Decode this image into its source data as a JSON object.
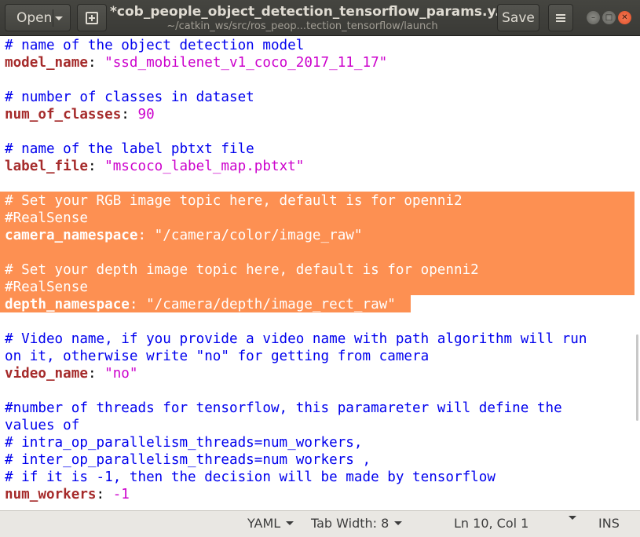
{
  "header": {
    "open_label": "Open",
    "save_label": "Save",
    "title": "*cob_people_object_detection_tensorflow_params.y...",
    "subtitle": "~/catkin_ws/src/ros_peop...tection_tensorflow/launch"
  },
  "lines": {
    "l1": "# name of the object detection model",
    "l2_key": "model_name",
    "l2_sep": ": ",
    "l2_val": "\"ssd_mobilenet_v1_coco_2017_11_17\"",
    "l4": "# number of classes in dataset",
    "l5_key": "num_of_classes",
    "l5_sep": ": ",
    "l5_val": "90",
    "l7": "# name of the label pbtxt file",
    "l8_key": "label_file",
    "l8_sep": ": ",
    "l8_val": "\"mscoco_label_map.pbtxt\"",
    "l10": "# Set your RGB image topic here, default is for openni2",
    "l11": "#RealSense",
    "l12_key": "camera_namespace",
    "l12_sep": ": ",
    "l12_val": "\"/camera/color/image_raw\"",
    "l14": "# Set your depth image topic here, default is for openni2",
    "l15": "#RealSense",
    "l16_key": "depth_namespace",
    "l16_sep": ": ",
    "l16_val": "\"/camera/depth/image_rect_raw\"",
    "l18": "# Video name, if you provide a video name with path algorithm will run",
    "l19": "on it, otherwise write \"no\" for getting from camera",
    "l20_key": "video_name",
    "l20_sep": ": ",
    "l20_val": "\"no\"",
    "l22": "#number of threads for tensorflow, this paramareter will define the",
    "l23": "values of",
    "l24": "# intra_op_parallelism_threads=num_workers,",
    "l25": "# inter_op_parallelism_threads=num workers ,",
    "l26": "# if it is -1, then the decision will be made by tensorflow",
    "l27_key": "num_workers",
    "l27_sep": ": ",
    "l27_val": "-1"
  },
  "status": {
    "language": "YAML",
    "tab_width": "Tab Width: 8",
    "position": "Ln 10, Col 1",
    "mode": "INS"
  },
  "colors": {
    "selection": "#fd9052",
    "comment": "#0000ee",
    "key": "#a52a2a",
    "string": "#cc00cc"
  }
}
